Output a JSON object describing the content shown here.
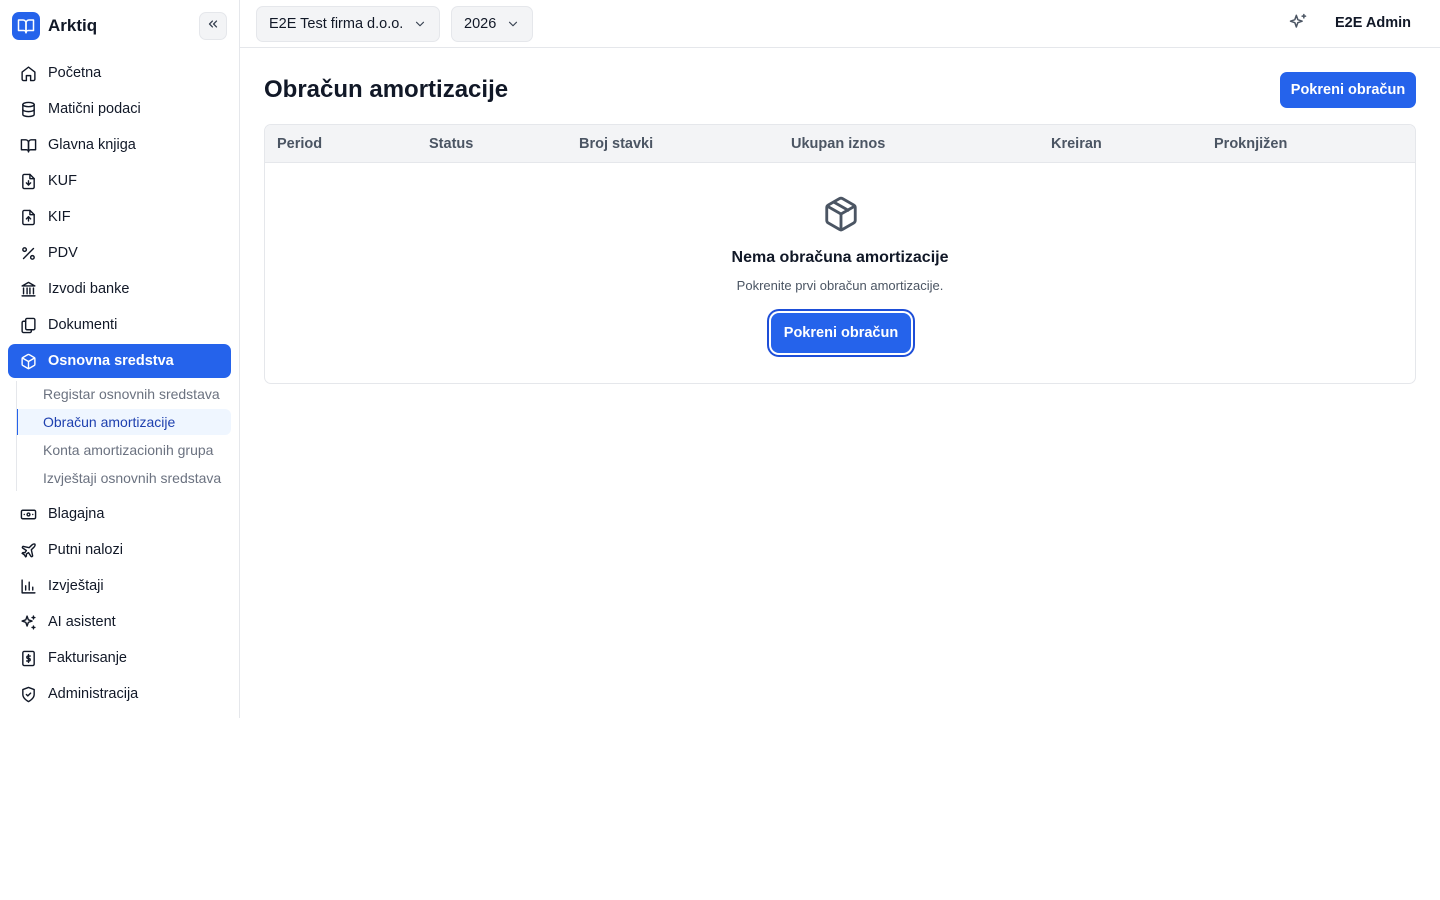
{
  "app": {
    "name": "Arktiq"
  },
  "sidebar": {
    "items": [
      {
        "label": "Početna",
        "icon": "home-icon"
      },
      {
        "label": "Matični podaci",
        "icon": "database-icon"
      },
      {
        "label": "Glavna knjiga",
        "icon": "book-open-icon"
      },
      {
        "label": "KUF",
        "icon": "file-download-icon"
      },
      {
        "label": "KIF",
        "icon": "file-upload-icon"
      },
      {
        "label": "PDV",
        "icon": "percent-icon"
      },
      {
        "label": "Izvodi banke",
        "icon": "bank-icon"
      },
      {
        "label": "Dokumenti",
        "icon": "documents-icon"
      },
      {
        "label": "Osnovna sredstva",
        "icon": "box-icon",
        "active": true
      },
      {
        "label": "Blagajna",
        "icon": "cash-icon"
      },
      {
        "label": "Putni nalozi",
        "icon": "plane-icon"
      },
      {
        "label": "Izvještaji",
        "icon": "bar-chart-icon"
      },
      {
        "label": "AI asistent",
        "icon": "sparkles-icon"
      },
      {
        "label": "Fakturisanje",
        "icon": "invoice-dollar-icon"
      },
      {
        "label": "Administracija",
        "icon": "shield-check-icon"
      }
    ],
    "subitems": [
      {
        "label": "Registar osnovnih sredstava"
      },
      {
        "label": "Obračun amortizacije",
        "active": true
      },
      {
        "label": "Konta amortizacionih grupa"
      },
      {
        "label": "Izvještaji osnovnih sredstava"
      }
    ]
  },
  "topbar": {
    "company": "E2E Test firma d.o.o.",
    "year": "2026",
    "user": "E2E Admin"
  },
  "main": {
    "title": "Obračun amortizacije",
    "primary_button": "Pokreni obračun",
    "table": {
      "columns": [
        "Period",
        "Status",
        "Broj stavki",
        "Ukupan iznos",
        "Kreiran",
        "Proknjižen"
      ]
    },
    "empty_state": {
      "icon": "package-icon",
      "title": "Nema obračuna amortizacije",
      "subtitle": "Pokrenite prvi obračun amortizacije.",
      "button": "Pokreni obračun"
    }
  },
  "colors": {
    "accent": "#2563eb",
    "active_sub_bg": "#eff6ff",
    "active_sub_text": "#1e40af",
    "border": "#e5e7eb",
    "header_bg": "#f3f4f6"
  }
}
